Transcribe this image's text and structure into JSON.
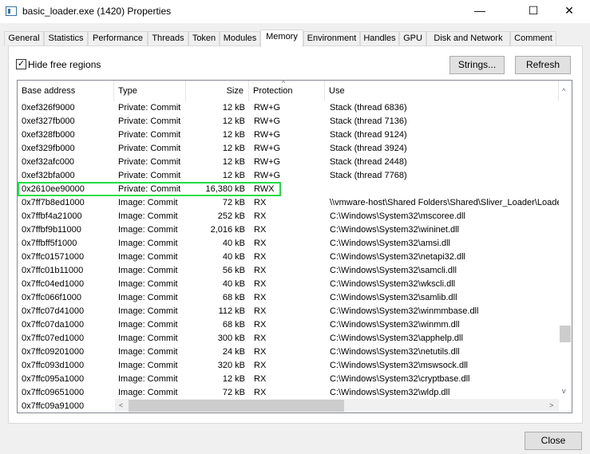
{
  "window": {
    "title": "basic_loader.exe (1420) Properties",
    "minimize": "—",
    "maximize": "☐",
    "close": "✕"
  },
  "tabs": [
    {
      "label": "General"
    },
    {
      "label": "Statistics"
    },
    {
      "label": "Performance"
    },
    {
      "label": "Threads"
    },
    {
      "label": "Token"
    },
    {
      "label": "Modules"
    },
    {
      "label": "Memory",
      "active": true
    },
    {
      "label": "Environment"
    },
    {
      "label": "Handles"
    },
    {
      "label": "GPU"
    },
    {
      "label": "Disk and Network"
    },
    {
      "label": "Comment"
    }
  ],
  "toolbar": {
    "hide_free_label": "Hide free regions",
    "hide_free_checked": true,
    "check_glyph": "✓",
    "strings_label": "Strings...",
    "refresh_label": "Refresh"
  },
  "columns": [
    "Base address",
    "Type",
    "Size",
    "Protection",
    "Use"
  ],
  "sort_column": "Protection",
  "highlight_color": "#22dd44",
  "rows": [
    [
      "0xef326f9000",
      "Private: Commit",
      "12 kB",
      "RW+G",
      "Stack (thread 6836)"
    ],
    [
      "0xef327fb000",
      "Private: Commit",
      "12 kB",
      "RW+G",
      "Stack (thread 7136)"
    ],
    [
      "0xef328fb000",
      "Private: Commit",
      "12 kB",
      "RW+G",
      "Stack (thread 9124)"
    ],
    [
      "0xef329fb000",
      "Private: Commit",
      "12 kB",
      "RW+G",
      "Stack (thread 3924)"
    ],
    [
      "0xef32afc000",
      "Private: Commit",
      "12 kB",
      "RW+G",
      "Stack (thread 2448)"
    ],
    [
      "0xef32bfa000",
      "Private: Commit",
      "12 kB",
      "RW+G",
      "Stack (thread 7768)"
    ],
    [
      "0x2610ee90000",
      "Private: Commit",
      "16,380 kB",
      "RWX",
      ""
    ],
    [
      "0x7ff7b8ed1000",
      "Image: Commit",
      "72 kB",
      "RX",
      "\\\\vmware-host\\Shared Folders\\Shared\\Sliver_Loader\\Loade"
    ],
    [
      "0x7ffbf4a21000",
      "Image: Commit",
      "252 kB",
      "RX",
      "C:\\Windows\\System32\\mscoree.dll"
    ],
    [
      "0x7ffbf9b11000",
      "Image: Commit",
      "2,016 kB",
      "RX",
      "C:\\Windows\\System32\\wininet.dll"
    ],
    [
      "0x7ffbff5f1000",
      "Image: Commit",
      "40 kB",
      "RX",
      "C:\\Windows\\System32\\amsi.dll"
    ],
    [
      "0x7ffc01571000",
      "Image: Commit",
      "40 kB",
      "RX",
      "C:\\Windows\\System32\\netapi32.dll"
    ],
    [
      "0x7ffc01b11000",
      "Image: Commit",
      "56 kB",
      "RX",
      "C:\\Windows\\System32\\samcli.dll"
    ],
    [
      "0x7ffc04ed1000",
      "Image: Commit",
      "40 kB",
      "RX",
      "C:\\Windows\\System32\\wkscli.dll"
    ],
    [
      "0x7ffc066f1000",
      "Image: Commit",
      "68 kB",
      "RX",
      "C:\\Windows\\System32\\samlib.dll"
    ],
    [
      "0x7ffc07d41000",
      "Image: Commit",
      "112 kB",
      "RX",
      "C:\\Windows\\System32\\winmmbase.dll"
    ],
    [
      "0x7ffc07da1000",
      "Image: Commit",
      "68 kB",
      "RX",
      "C:\\Windows\\System32\\winmm.dll"
    ],
    [
      "0x7ffc07ed1000",
      "Image: Commit",
      "300 kB",
      "RX",
      "C:\\Windows\\System32\\apphelp.dll"
    ],
    [
      "0x7ffc09201000",
      "Image: Commit",
      "24 kB",
      "RX",
      "C:\\Windows\\System32\\netutils.dll"
    ],
    [
      "0x7ffc093d1000",
      "Image: Commit",
      "320 kB",
      "RX",
      "C:\\Windows\\System32\\mswsock.dll"
    ],
    [
      "0x7ffc095a1000",
      "Image: Commit",
      "12 kB",
      "RX",
      "C:\\Windows\\System32\\cryptbase.dll"
    ],
    [
      "0x7ffc09651000",
      "Image: Commit",
      "72 kB",
      "RX",
      "C:\\Windows\\System32\\wldp.dll"
    ],
    [
      "0x7ffc09a91000",
      "",
      "",
      "",
      ""
    ]
  ],
  "footer": {
    "close_label": "Close"
  }
}
